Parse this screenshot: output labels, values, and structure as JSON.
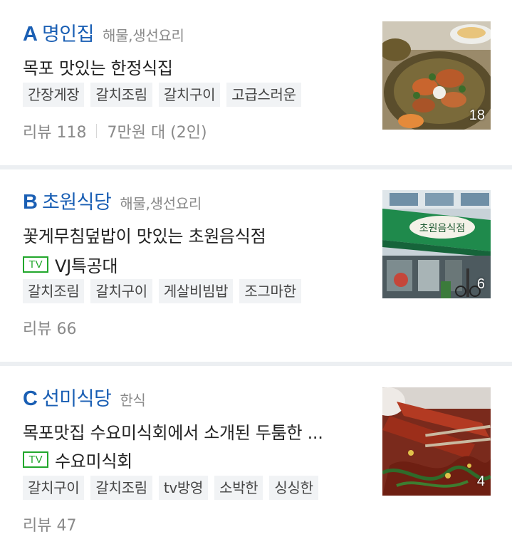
{
  "restaurants": [
    {
      "letter": "A",
      "name": "명인집",
      "category": "해물,생선요리",
      "description": "목포 맛있는 한정식집",
      "tags": [
        "간장게장",
        "갈치조림",
        "갈치구이",
        "고급스러운"
      ],
      "review_label": "리뷰 118",
      "price_label": "7만원 대 (2인)",
      "photo_count": "18",
      "thumb_icon": "crab-dish-photo"
    },
    {
      "letter": "B",
      "name": "초원식당",
      "category": "해물,생선요리",
      "description": "꽃게무침덮밥이 맛있는 초원음식점",
      "tv_badge": "TV",
      "tv_program": "VJ특공대",
      "tags": [
        "갈치조림",
        "갈치구이",
        "게살비빔밥",
        "조그마한"
      ],
      "review_label": "리뷰 66",
      "photo_count": "6",
      "thumb_icon": "storefront-photo",
      "sign_text": "초원음식점"
    },
    {
      "letter": "C",
      "name": "선미식당",
      "category": "한식",
      "description": "목포맛집 수요미식회에서 소개된 두툼한 ...",
      "tv_badge": "TV",
      "tv_program": "수요미식회",
      "tags": [
        "갈치구이",
        "갈치조림",
        "tv방영",
        "소박한",
        "싱싱한"
      ],
      "review_label": "리뷰 47",
      "photo_count": "4",
      "thumb_icon": "braised-fish-photo"
    }
  ],
  "colors": {
    "name_blue": "#1a5fb4",
    "tv_green": "#22a72c",
    "gray_text": "#8a8a8a",
    "tag_bg": "#f1f3f5",
    "separator": "#eceff2"
  }
}
